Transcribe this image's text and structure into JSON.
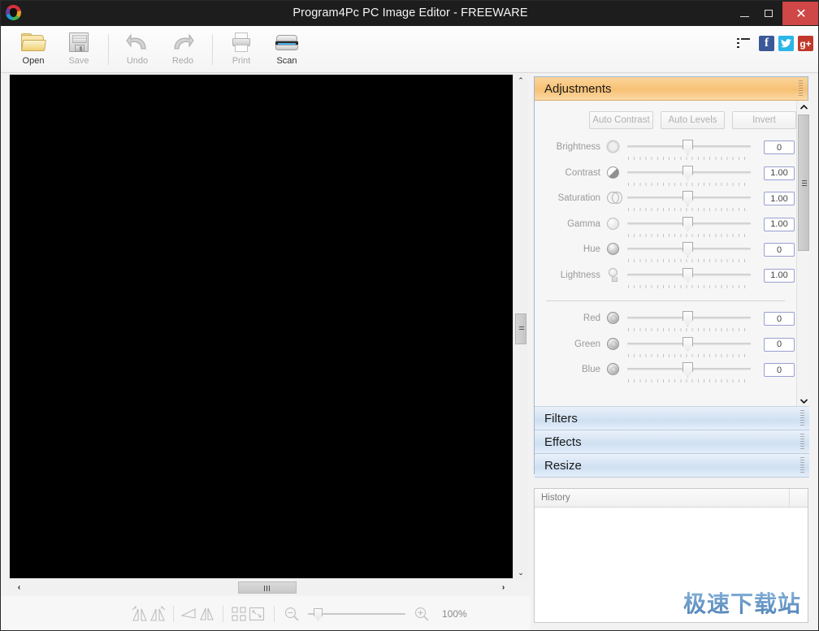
{
  "window": {
    "title": "Program4Pc PC Image Editor - FREEWARE",
    "logo_icon": "app-logo-icon",
    "minimize_label": "—",
    "maximize_label": "□",
    "close_label": "✕"
  },
  "toolbar": {
    "items": [
      {
        "label": "Open",
        "icon": "folder-open-icon",
        "enabled": true
      },
      {
        "label": "Save",
        "icon": "floppy-disk-icon",
        "enabled": false
      },
      {
        "label": "Undo",
        "icon": "undo-arrow-icon",
        "enabled": false
      },
      {
        "label": "Redo",
        "icon": "redo-arrow-icon",
        "enabled": false
      },
      {
        "label": "Print",
        "icon": "printer-icon",
        "enabled": false
      },
      {
        "label": "Scan",
        "icon": "scanner-icon",
        "enabled": true
      }
    ],
    "right_icons": [
      {
        "name": "list-menu-icon",
        "label": ""
      },
      {
        "name": "facebook-icon",
        "label": "f",
        "color": "#3b5998"
      },
      {
        "name": "twitter-icon",
        "label": "✉",
        "color": "#29b6e8"
      },
      {
        "name": "googleplus-icon",
        "label": "g+",
        "color": "#c0392b"
      }
    ]
  },
  "panel": {
    "sections": [
      {
        "name": "adjustments",
        "label": "Adjustments",
        "expanded": true
      },
      {
        "name": "filters",
        "label": "Filters",
        "expanded": false
      },
      {
        "name": "effects",
        "label": "Effects",
        "expanded": false
      },
      {
        "name": "resize",
        "label": "Resize",
        "expanded": false
      }
    ],
    "auto_buttons": [
      {
        "label": "Auto Contrast"
      },
      {
        "label": "Auto Levels"
      },
      {
        "label": "Invert"
      }
    ],
    "sliders_group_1": [
      {
        "label": "Brightness",
        "value": "0",
        "icon": "brightness-icon"
      },
      {
        "label": "Contrast",
        "value": "1.00",
        "icon": "contrast-icon"
      },
      {
        "label": "Saturation",
        "value": "1.00",
        "icon": "saturation-icon"
      },
      {
        "label": "Gamma",
        "value": "1.00",
        "icon": "gamma-icon"
      },
      {
        "label": "Hue",
        "value": "0",
        "icon": "hue-icon"
      },
      {
        "label": "Lightness",
        "value": "1.00",
        "icon": "lightness-icon"
      }
    ],
    "sliders_group_2": [
      {
        "label": "Red",
        "value": "0",
        "icon": "red-channel-icon"
      },
      {
        "label": "Green",
        "value": "0",
        "icon": "green-channel-icon"
      },
      {
        "label": "Blue",
        "value": "0",
        "icon": "blue-channel-icon"
      }
    ],
    "scroll_up": "▲",
    "scroll_down": "▼"
  },
  "history": {
    "column_header": "History",
    "rows": []
  },
  "canvas": {
    "scroll_up": "⌃",
    "scroll_down": "⌄",
    "scroll_left": "‹",
    "scroll_right": "›"
  },
  "statusbar": {
    "zoom_percent": "100%",
    "tools": [
      {
        "name": "rotate-left-icon"
      },
      {
        "name": "rotate-right-icon"
      },
      {
        "name": "flip-horizontal-icon"
      },
      {
        "name": "flip-vertical-icon"
      },
      {
        "name": "crop-icon"
      },
      {
        "name": "fit-to-screen-icon"
      },
      {
        "name": "zoom-out-icon"
      },
      {
        "name": "zoom-in-icon"
      }
    ]
  },
  "watermark": {
    "text": "极速下载站"
  },
  "colors": {
    "titlebar": "#1d1d1d",
    "close_button": "#cf4747",
    "accordion_active": "#f7c174",
    "accordion_inactive": "#cfe0f2",
    "canvas": "#000000",
    "facebook": "#3b5998",
    "twitter": "#29b6e8",
    "googleplus": "#c0392b",
    "watermark": "#4a7fb5"
  }
}
